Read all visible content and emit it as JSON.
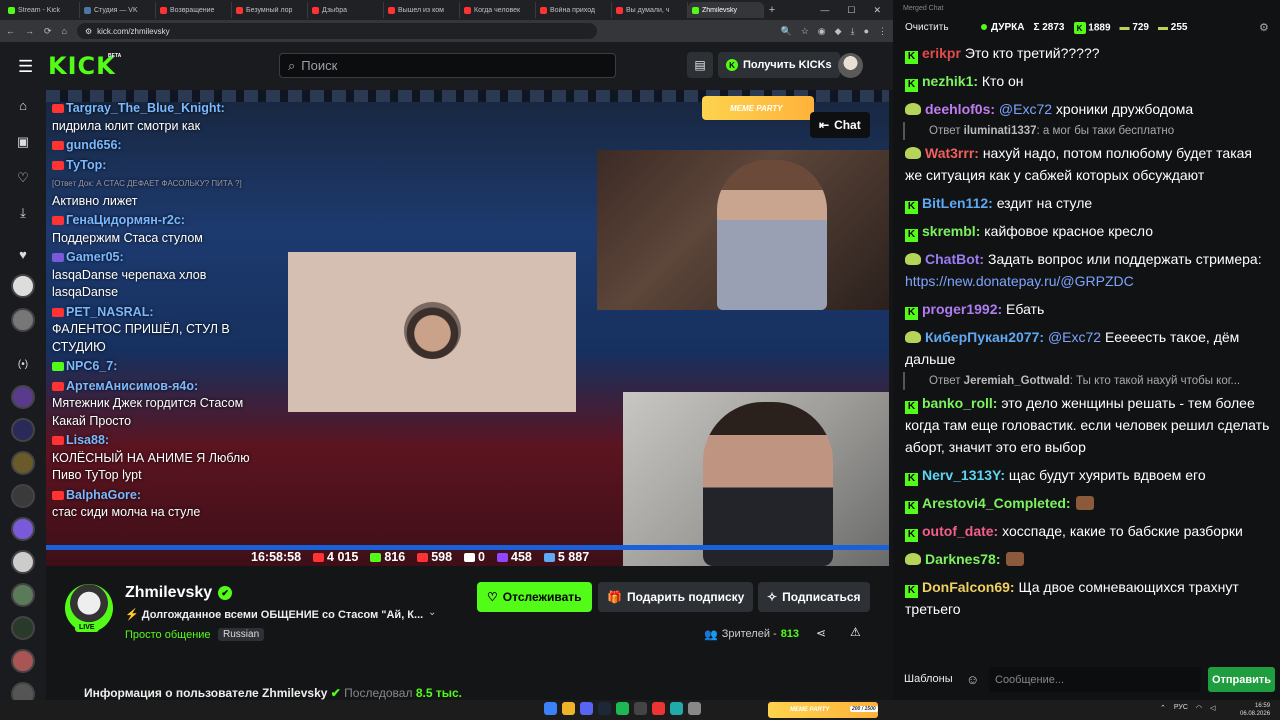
{
  "browser": {
    "tabs": [
      {
        "label": "Stream - Kick",
        "color": "#53fc18"
      },
      {
        "label": "Студия — VK",
        "color": "#4a76a8"
      },
      {
        "label": "Возвращение",
        "color": "#f33"
      },
      {
        "label": "Безумный лор",
        "color": "#f33"
      },
      {
        "label": "Дзыбра",
        "color": "#f33"
      },
      {
        "label": "Вышел из ком",
        "color": "#f33"
      },
      {
        "label": "Когда человек",
        "color": "#f33"
      },
      {
        "label": "Война приход",
        "color": "#f33"
      },
      {
        "label": "Вы думали, ч",
        "color": "#f33"
      },
      {
        "label": "Zhmilevsky",
        "color": "#53fc18"
      }
    ],
    "url": "kick.com/zhmilevsky"
  },
  "header": {
    "search_placeholder": "Поиск",
    "kicks_label": "Получить KICKs",
    "logo": "KICK",
    "beta": "BETA"
  },
  "player": {
    "meme_badge": "MEME PARTY",
    "chat_toggle": "Chat",
    "overlay_chat": [
      {
        "user": "Targray_The_Blue_Knight:",
        "text": "пидрила юлит смотри как",
        "src": "#f33"
      },
      {
        "user": "gund656:",
        "text": "",
        "src": "#f33"
      },
      {
        "user": "ТуТор:",
        "quote": "[Ответ Док: А СТАС ДЕФАЕТ ФАСОЛЬКУ? ПИТА ?]",
        "text": "Активно лижет",
        "src": "#f33"
      },
      {
        "user": "ГенаЦидормян-r2c:",
        "text": "Поддержим Стаса стулом",
        "src": "#f33"
      },
      {
        "user": "Gamer05:",
        "text": "lasqaDanse черепаха хлов lasqaDanse",
        "src": "#7a5ad9"
      },
      {
        "user": "PET_NASRAL:",
        "text": "ФАЛЕНТОС ПРИШЁЛ, СТУЛ В СТУДИЮ",
        "src": "#f33"
      },
      {
        "user": "NPC6_7:",
        "text": "",
        "src": "#53fc18"
      },
      {
        "user": "АртемАнисимов-я4о:",
        "text": "Мятежник Джек гордится Стасом Какай Просто",
        "src": "#f33"
      },
      {
        "user": "Lisa88:",
        "text": "КОЛЁСНЫЙ НА АНИМЕ Я Люблю Пиво ТуТор lypt",
        "src": "#f33"
      },
      {
        "user": "BalphaGore:",
        "text": "стас сиди молча на стуле",
        "src": "#f33"
      }
    ],
    "stats": {
      "time": "16:58:58",
      "yt": "4 015",
      "kick": "816",
      "vk": "598",
      "r": "0",
      "tw": "458",
      "total": "5 887"
    }
  },
  "channel": {
    "name": "Zhmilevsky",
    "live": "LIVE",
    "title": "Долгожданное всеми ОБЩЕНИЕ со Стасом \"Ай, К...",
    "category": "Просто общение",
    "language": "Russian",
    "follow": "Отслеживать",
    "gift": "Подарить подписку",
    "subscribe": "Подписаться",
    "viewers_label": "Зрителей -",
    "viewers": "813",
    "about_prefix": "Информация о пользователе Zhmilevsky",
    "about_follow": "Последовал",
    "about_time": "8.5 тыс."
  },
  "merged": {
    "window_title": "Merged Chat",
    "clear": "Очистить",
    "stats": {
      "title": "ДУРКА",
      "sum": "Σ 2873",
      "kick": "1889",
      "yt": "729",
      "tw": "255"
    },
    "messages": [
      {
        "type": "kick",
        "user": "erikpr",
        "color": "#e24b4b",
        "text": "Это кто третий?????"
      },
      {
        "type": "kick",
        "user": "nezhik1:",
        "color": "#7cf25f",
        "text": "Кто он"
      },
      {
        "type": "yt",
        "user": "deehlof0s:",
        "color": "#c07cf2",
        "mention": "@Exc72",
        "text": "хроники дружбодома"
      },
      {
        "type": "reply",
        "user": "iluminati1337",
        "text": ": а мог бы таки бесплатно"
      },
      {
        "type": "yt",
        "user": "Wat3rrr:",
        "color": "#f25f5f",
        "text": "нахуй надо, потом полюбому будет такая же ситуация как у сабжей которых обсуждают"
      },
      {
        "type": "kick",
        "user": "BitLen112:",
        "color": "#5fa8f2",
        "text": "ездит на стуле"
      },
      {
        "type": "kick",
        "user": "skrembl:",
        "color": "#7cf25f",
        "text": "кайфовое красное кресло"
      },
      {
        "type": "yt",
        "user": "ChatBot:",
        "color": "#9b7cf2",
        "text": "Задать вопрос или поддержать стримера:",
        "link": "https://new.donatepay.ru/@GRPZDC"
      },
      {
        "type": "kick",
        "user": "proger1992:",
        "color": "#b07cf2",
        "text": "Ебать"
      },
      {
        "type": "yt",
        "user": "КиберПукан2077:",
        "color": "#5fa8f2",
        "mention": "@Exc72",
        "text": "Еееееcть такое, дём дальше"
      },
      {
        "type": "reply",
        "user": "Jeremiah_Gottwald",
        "text": ": Ты кто такой нахуй чтобы ког..."
      },
      {
        "type": "kick",
        "user": "banko_roll:",
        "color": "#7cf25f",
        "text": "это дело женщины решать - тем более когда там еще головастик. если человек решил сделать аборт, значит это его выбор"
      },
      {
        "type": "kick",
        "user": "Nerv_1313Y:",
        "color": "#5fd4f2",
        "text": "щас будут хуярить вдвоем его"
      },
      {
        "type": "kick",
        "user": "Arestovi4_Completed:",
        "color": "#7cf25f",
        "text": ""
      },
      {
        "type": "kick",
        "user": "outof_date:",
        "color": "#f25f8a",
        "text": "хосспаде, какие то бабские разборки"
      },
      {
        "type": "yt",
        "user": "Darknes78:",
        "color": "#7cf25f",
        "text": ""
      },
      {
        "type": "kick",
        "user": "DonFalcon69:",
        "color": "#f2d05f",
        "text": "Ща двое сомневающихся трахнут третьего"
      }
    ],
    "templates": "Шаблоны",
    "input_placeholder": "Сообщение...",
    "send": "Отправить"
  },
  "taskbar": {
    "meme": "MEME PARTY",
    "counter": "200 / 1500",
    "lang": "РУС",
    "time": "16:59",
    "date": "06.08.2026"
  }
}
